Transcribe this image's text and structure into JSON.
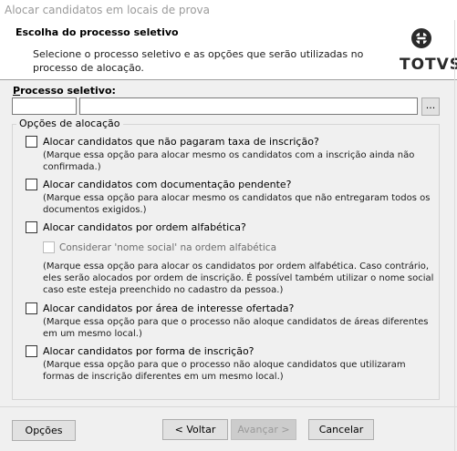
{
  "window": {
    "title": "Alocar candidatos em locais de prova"
  },
  "header": {
    "title": "Escolha do processo seletivo",
    "description": "Selecione o processo seletivo e as opções que serão utilizadas no processo de alocação.",
    "brand": "TOTVS"
  },
  "process": {
    "label_prefix": "P",
    "label_rest": "rocesso seletivo:",
    "code_value": "",
    "description_value": "",
    "lookup_label": "..."
  },
  "allocation": {
    "group_title": "Opções de alocação",
    "options": [
      {
        "label": "Alocar candidatos que não pagaram taxa de inscrição?",
        "note": "(Marque essa opção para alocar mesmo os candidatos com a inscrição ainda não confirmada.)",
        "checked": false
      },
      {
        "label": "Alocar candidatos com documentação pendente?",
        "note": "(Marque essa opção para alocar mesmo os candidatos que não entregaram todos os documentos exigidos.)",
        "checked": false
      },
      {
        "label": "Alocar candidatos por ordem alfabética?",
        "sub_option": {
          "label": "Considerar 'nome social' na ordem alfabética",
          "enabled": false,
          "checked": false
        },
        "note": "(Marque essa opção para alocar os candidatos por ordem alfabética. Caso contrário, eles serão alocados por ordem de inscrição. É possível também utilizar o nome social caso este esteja preenchido no cadastro da pessoa.)",
        "checked": false
      },
      {
        "label": "Alocar candidatos por área de interesse ofertada?",
        "note": "(Marque essa opção para que o processo não aloque candidatos de áreas diferentes em um mesmo local.)",
        "checked": false
      },
      {
        "label": "Alocar candidatos por forma de inscrição?",
        "note": "(Marque essa opção para que o processo não aloque candidatos que utilizaram formas de inscrição diferentes em um mesmo local.)",
        "checked": false
      }
    ]
  },
  "footer": {
    "options_label": "Opções",
    "back_label": "< Voltar",
    "next_label": "Avançar >",
    "cancel_label": "Cancelar"
  }
}
